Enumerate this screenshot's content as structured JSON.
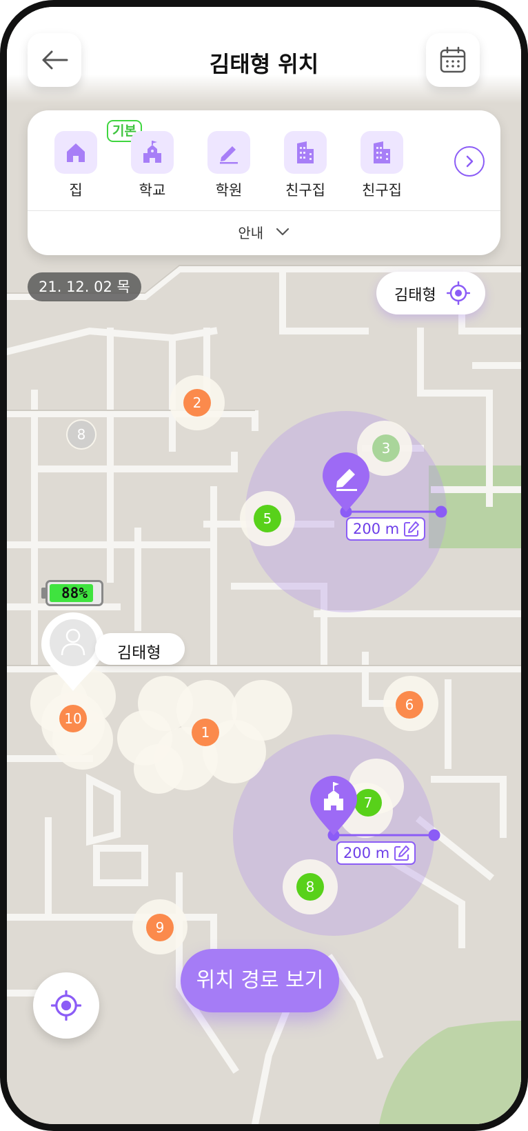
{
  "header": {
    "title": "김태형 위치",
    "back_icon": "arrow-left-icon",
    "calendar_icon": "calendar-icon"
  },
  "places": {
    "items": [
      {
        "label": "집",
        "icon": "home-icon"
      },
      {
        "label": "학교",
        "icon": "school-icon"
      },
      {
        "label": "학원",
        "icon": "pencil-icon"
      },
      {
        "label": "친구집",
        "icon": "building-icon"
      },
      {
        "label": "친구집",
        "icon": "building-icon"
      }
    ],
    "default_badge": "기본",
    "guide_label": "안내"
  },
  "map": {
    "date": "21. 12. 02 목",
    "child_pill_name": "김태형",
    "user_name": "김태형",
    "battery": "88%",
    "battery_level": 0.88,
    "geofence_radius_1": "200 m",
    "geofence_radius_2": "200 m",
    "markers": [
      "1",
      "2",
      "3",
      "5",
      "6",
      "7",
      "8",
      "8",
      "9",
      "10"
    ],
    "colors": {
      "accent": "#8b5cf6",
      "orange": "#fb8a4c",
      "green": "#58d11a",
      "gray": "#cfcfcf",
      "map_bg": "#dedad3"
    }
  },
  "cta": {
    "label": "위치 경로 보기"
  }
}
